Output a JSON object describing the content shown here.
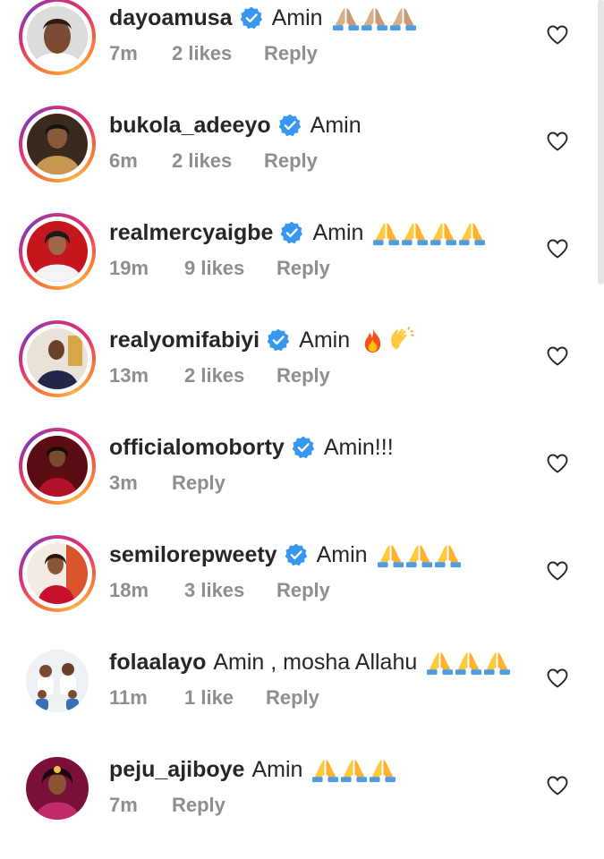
{
  "comments": [
    {
      "username": "dayoamusa",
      "verified": true,
      "text": "Amin",
      "emoji": "pray-light-skin-x3",
      "time": "7m",
      "likes": "2 likes",
      "reply": "Reply"
    },
    {
      "username": "bukola_adeeyo",
      "verified": true,
      "text": "Amin",
      "emoji": "",
      "time": "6m",
      "likes": "2 likes",
      "reply": "Reply"
    },
    {
      "username": "realmercyaigbe",
      "verified": true,
      "text": "Amin",
      "emoji": "pray-x4",
      "time": "19m",
      "likes": "9 likes",
      "reply": "Reply"
    },
    {
      "username": "realyomifabiyi",
      "verified": true,
      "text": "Amin",
      "emoji": "fire-clap",
      "time": "13m",
      "likes": "2 likes",
      "reply": "Reply"
    },
    {
      "username": "officialomoborty",
      "verified": true,
      "text": "Amin!!!",
      "emoji": "",
      "time": "3m",
      "likes": "",
      "reply": "Reply"
    },
    {
      "username": "semilorepweety",
      "verified": true,
      "text": "Amin",
      "emoji": "pray-x3",
      "time": "18m",
      "likes": "3 likes",
      "reply": "Reply"
    },
    {
      "username": "folaalayo",
      "verified": false,
      "text": "Amin , mosha Allahu",
      "emoji": "pray-x3",
      "time": "11m",
      "likes": "1 like",
      "reply": "Reply"
    },
    {
      "username": "peju_ajiboye",
      "verified": false,
      "text": "Amin",
      "emoji": "pray-x3",
      "time": "7m",
      "likes": "",
      "reply": "Reply"
    }
  ],
  "icons": {
    "verified_badge": "verified-badge-icon",
    "like": "heart-outline-icon",
    "pray": "folded-hands-emoji",
    "fire": "fire-emoji",
    "clap": "clapping-hands-emoji"
  },
  "colors": {
    "username": "#262626",
    "meta": "#8e8e8e",
    "verified": "#3897f0",
    "story_ring_start": "#c13584",
    "story_ring_end": "#fcaf45"
  }
}
